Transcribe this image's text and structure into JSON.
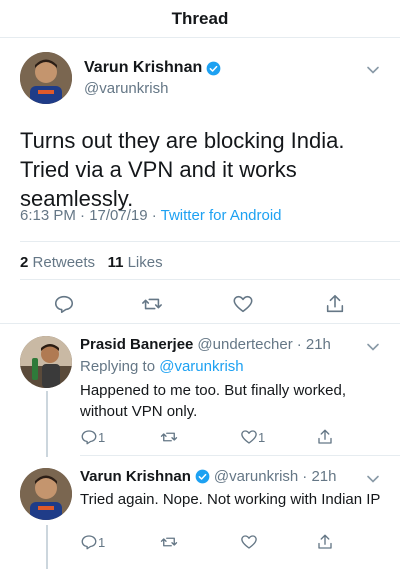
{
  "header": {
    "title": "Thread"
  },
  "main_tweet": {
    "name": "Varun Krishnan",
    "handle": "@varunkrish",
    "text": "Turns out they are blocking India. Tried via a VPN and it works seamlessly.",
    "time_date": "6:13 PM · 17/07/19 · ",
    "source": "Twitter for Android",
    "retweets_count": "2",
    "retweets_label": "Retweets",
    "likes_count": "11",
    "likes_label": "Likes"
  },
  "replies": [
    {
      "name": "Prasid Banerjee",
      "handle": "@undertecher",
      "time": "· 21h",
      "replying_prefix": "Replying to",
      "replying_to": "@varunkrish",
      "text": "Happened to me too. But finally worked, without VPN only.",
      "reply_count": "1",
      "retweet_count": "",
      "like_count": "1"
    },
    {
      "name": "Varun Krishnan",
      "handle": "@varunkrish",
      "time": "· 21h",
      "text": "Tried again. Nope. Not working with Indian IP",
      "reply_count": "1",
      "retweet_count": "",
      "like_count": ""
    }
  ],
  "colors": {
    "accent": "#1da1f2",
    "muted": "#657786",
    "text": "#14171a",
    "divider": "#e6ecf0"
  }
}
